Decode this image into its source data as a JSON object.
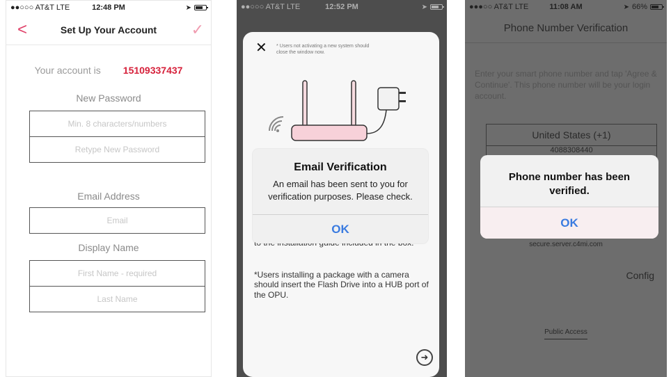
{
  "screens": {
    "setup": {
      "status": {
        "carrier": "●●○○○ AT&T  LTE",
        "time": "12:48 PM"
      },
      "nav": {
        "title": "Set Up Your Account",
        "back_icon": "chevron-left-icon",
        "confirm_icon": "checkmark-icon"
      },
      "account_label": "Your account is",
      "account_number": "15109337437",
      "password_label": "New Password",
      "password_placeholder": "Min. 8 characters/numbers",
      "retype_placeholder": "Retype New Password",
      "email_label": "Email Address",
      "email_placeholder": "Email",
      "display_name_label": "Display Name",
      "first_name_placeholder": "First Name - required",
      "last_name_placeholder": "Last Name"
    },
    "email_verification": {
      "status": {
        "carrier": "●●○○○ AT&T  LTE",
        "time": "12:52 PM"
      },
      "close_icon": "close-icon",
      "top_note": "* Users not activating a new system should close the window now.",
      "body_text_1": "to the installation guide included in the box.",
      "body_text_2": "*Users installing a package with a camera should insert the Flash Drive into a HUB port of the OPU.",
      "alert": {
        "title": "Email Verification",
        "message": "An email has been sent to you for verification purposes. Please check.",
        "button": "OK"
      },
      "next_icon": "arrow-right-circle-icon"
    },
    "phone_verification": {
      "status": {
        "carrier": "●●●○○ AT&T  LTE",
        "time": "11:08 AM",
        "battery": "66%"
      },
      "nav": {
        "title": "Phone Number Verification"
      },
      "instructions": "Enter your smart phone number and tap 'Agree & Continue'. This phone number will be your login account.",
      "country": "United States (+1)",
      "phone_number": "4088308440",
      "alert": {
        "message": "Phone number has been verified.",
        "button": "OK"
      },
      "server": "secure.server.c4mi.com",
      "config": "Config",
      "public_access": "Public Access"
    }
  },
  "colors": {
    "accent_red": "#d6203a",
    "accent_pink": "#e0446b",
    "ios_blue": "#3a7be0"
  }
}
